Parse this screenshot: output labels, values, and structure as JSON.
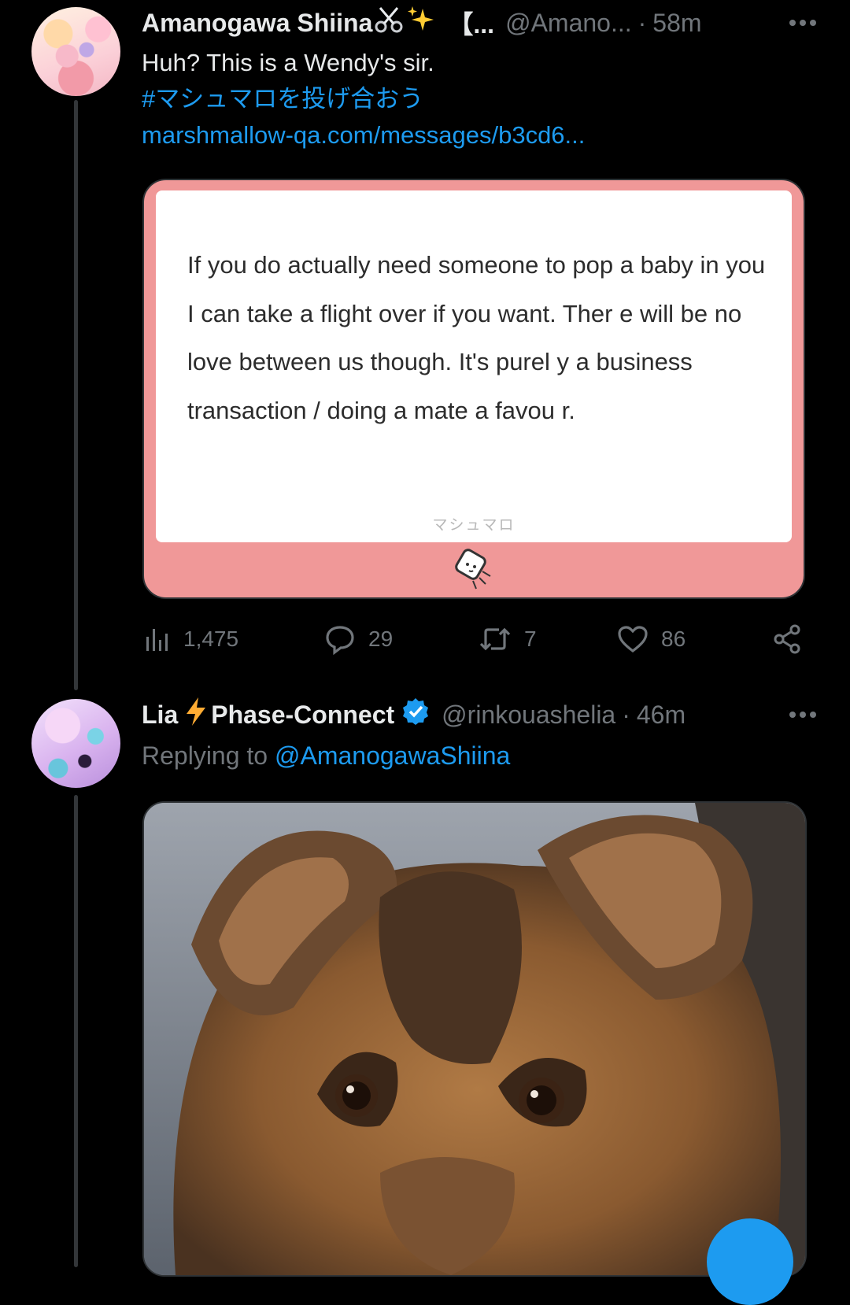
{
  "tweet1": {
    "name": "Amanogawa Shiina",
    "name_suffix": "【...",
    "handle": "@Amano...",
    "time": "58m",
    "text": "Huh? This is a Wendy's sir.",
    "hashtag": "#マシュマロを投げ合おう",
    "link": "marshmallow-qa.com/messages/b3cd6...",
    "card": {
      "body": "If you do actually need someone to pop a baby in you I can take a flight over if you want. Ther e will be no love between us though. It's purel y a business transaction / doing a mate a favou r.",
      "brand": "マシュマロ"
    },
    "stats": {
      "views": "1,475",
      "replies": "29",
      "retweets": "7",
      "likes": "86"
    }
  },
  "tweet2": {
    "name_prefix": "Lia",
    "name_suffix": "Phase-Connect",
    "handle": "@rinkouashelia",
    "time": "46m",
    "replying_label": "Replying to",
    "replying_handle": "@AmanogawaShiina"
  },
  "colors": {
    "background": "#000000",
    "text_primary": "#e7e9ea",
    "text_secondary": "#71767b",
    "link": "#1d9bf0",
    "card_border_pink": "#f09898",
    "verified": "#1d9bf0"
  },
  "icons": [
    "more-icon",
    "scissors-icon",
    "sparkles-icon",
    "views-icon",
    "reply-icon",
    "retweet-icon",
    "like-icon",
    "share-icon",
    "lightning-icon",
    "verified-icon",
    "marshmallow-logo-icon"
  ]
}
